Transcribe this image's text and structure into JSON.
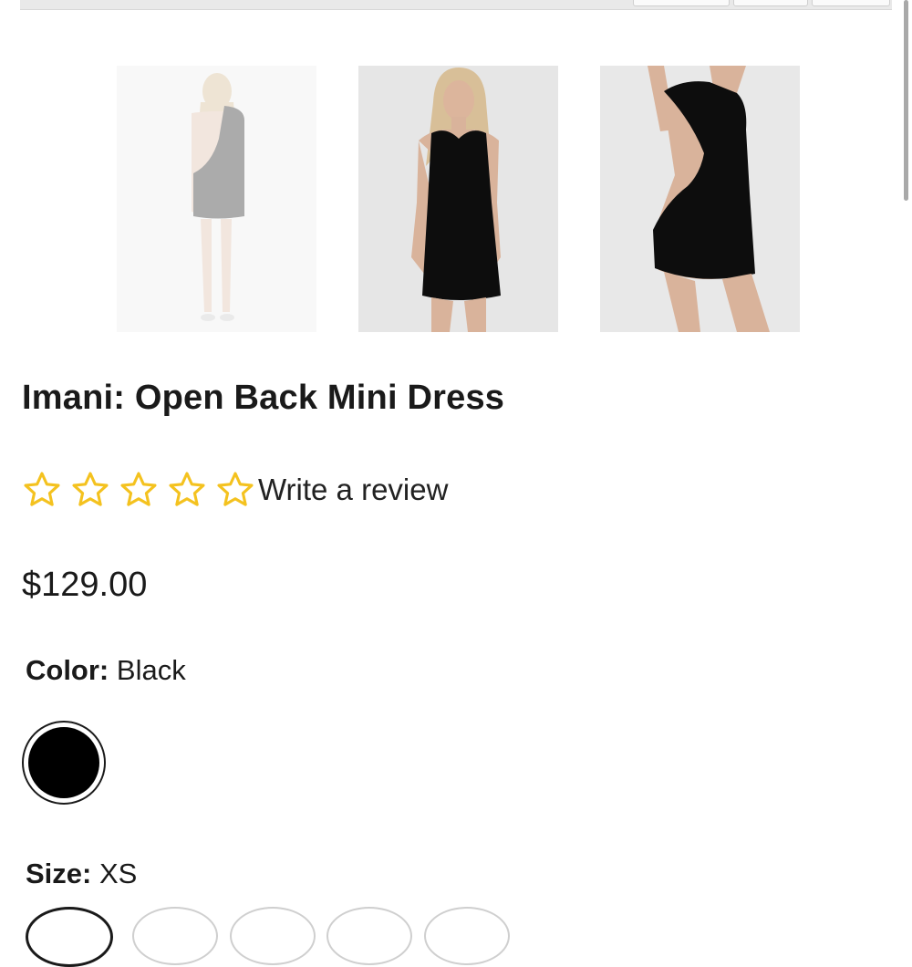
{
  "product": {
    "title": "Imani: Open Back Mini Dress",
    "price": "$129.00",
    "rating": {
      "filled_stars": 0,
      "max_stars": 5,
      "review_link": "Write a review"
    },
    "color": {
      "label": "Color:",
      "selected": "Black"
    },
    "size": {
      "label": "Size:",
      "selected": "XS"
    }
  },
  "gallery": {
    "thumbnails": [
      {
        "name": "back-view",
        "active": false
      },
      {
        "name": "front-view",
        "active": true
      },
      {
        "name": "side-back-view",
        "active": false
      }
    ]
  },
  "swatches": [
    {
      "name": "Black",
      "color": "#000000",
      "selected": true
    }
  ],
  "colors": {
    "star": "#f4c21f",
    "text": "#1a1a1a",
    "dress": "#0d0d0d",
    "skin": "#d9b39b",
    "hair": "#d8c19b"
  }
}
